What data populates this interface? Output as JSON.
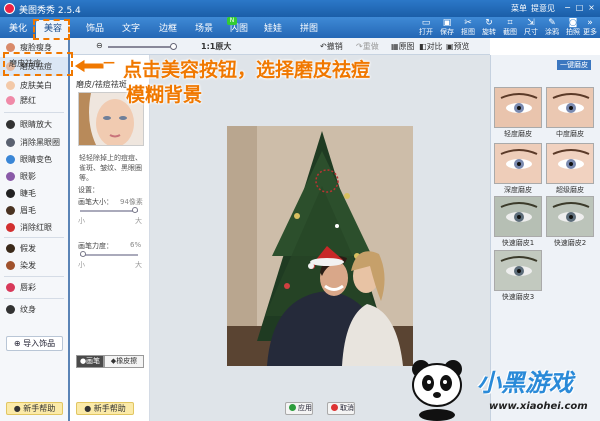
{
  "window": {
    "title": "美图秀秀 2.5.4",
    "menu": "菜单",
    "feedback": "提意见"
  },
  "nav": {
    "tabs": [
      {
        "label": "美化"
      },
      {
        "label": "美容"
      },
      {
        "label": "饰品"
      },
      {
        "label": "文字"
      },
      {
        "label": "边框"
      },
      {
        "label": "场景"
      },
      {
        "label": "闪图"
      },
      {
        "label": "娃娃"
      },
      {
        "label": "拼图"
      }
    ],
    "new_badge": "N",
    "active_tab": "美容",
    "toolbar": [
      {
        "label": "打开",
        "icon": "folder-icon"
      },
      {
        "label": "保存",
        "icon": "save-icon"
      },
      {
        "label": "抠图",
        "icon": "scissors-icon"
      },
      {
        "label": "旋转",
        "icon": "rotate-icon"
      },
      {
        "label": "截图",
        "icon": "screenshot-icon"
      },
      {
        "label": "尺寸",
        "icon": "resize-icon"
      },
      {
        "label": "涂鸦",
        "icon": "brush-icon"
      },
      {
        "label": "拍照",
        "icon": "camera-icon"
      },
      {
        "label": "更多",
        "icon": "more-icon"
      }
    ]
  },
  "subtoolbar": {
    "zoom_label": "1:1原大",
    "undo": "撤销",
    "redo": "重做",
    "original": "原图",
    "compare": "对比",
    "preview": "预览"
  },
  "left_panel": {
    "items": [
      {
        "label": "瘦脸瘦身",
        "color": "#d98a6a"
      },
      {
        "label": "磨皮祛痘",
        "color": "#e6b9a0"
      },
      {
        "label": "皮肤美白",
        "color": "#f3c9a8"
      },
      {
        "label": "腮红",
        "color": "#f08aa8"
      },
      {
        "label": "眼睛放大",
        "color": "#333333"
      },
      {
        "label": "消除黑眼圈",
        "color": "#5a6170"
      },
      {
        "label": "眼睛变色",
        "color": "#3a86d6"
      },
      {
        "label": "眼影",
        "color": "#8a5aa8"
      },
      {
        "label": "睫毛",
        "color": "#222222"
      },
      {
        "label": "眉毛",
        "color": "#4a3322"
      },
      {
        "label": "消除红眼",
        "color": "#d23030"
      },
      {
        "label": "假发",
        "color": "#3b2a1a"
      },
      {
        "label": "染发",
        "color": "#a0522d"
      },
      {
        "label": "唇彩",
        "color": "#d8395a"
      },
      {
        "label": "纹身",
        "color": "#333333"
      }
    ],
    "import_button": "导入饰品",
    "help_button": "新手帮助"
  },
  "effect_panel": {
    "tab_label": "磨皮祛痘",
    "header": "磨皮/祛痘祛斑",
    "description": "轻轻除掉上的痘痘、雀斑、皱纹、黑眼圈等。",
    "settings_label": "设置：",
    "brush_size_label": "画笔大小：",
    "brush_size_value": "94像素",
    "brush_strength_label": "画笔力度：",
    "brush_strength_value": "6%",
    "min_label": "小",
    "max_label": "大",
    "brush_size_fraction": 0.94,
    "brush_strength_fraction": 0.06,
    "brush_toggle": "画笔",
    "eraser_toggle": "橡皮擦",
    "help_button": "新手帮助"
  },
  "canvas": {
    "apply_button": "应用",
    "cancel_button": "取消"
  },
  "right_panel": {
    "header": "一键磨皮",
    "presets": [
      {
        "label": "轻度磨皮"
      },
      {
        "label": "中度磨皮"
      },
      {
        "label": "深度磨皮"
      },
      {
        "label": "超级磨皮"
      },
      {
        "label": "快速磨皮1"
      },
      {
        "label": "快速磨皮2"
      },
      {
        "label": "快速磨皮3"
      }
    ]
  },
  "annotations": {
    "line1": "点击美容按钮，选择磨皮祛痘",
    "line2": "模糊背景",
    "color": "#f07800"
  },
  "watermark": {
    "brand": "小黑游戏",
    "url": "www.xiaohei.com"
  }
}
